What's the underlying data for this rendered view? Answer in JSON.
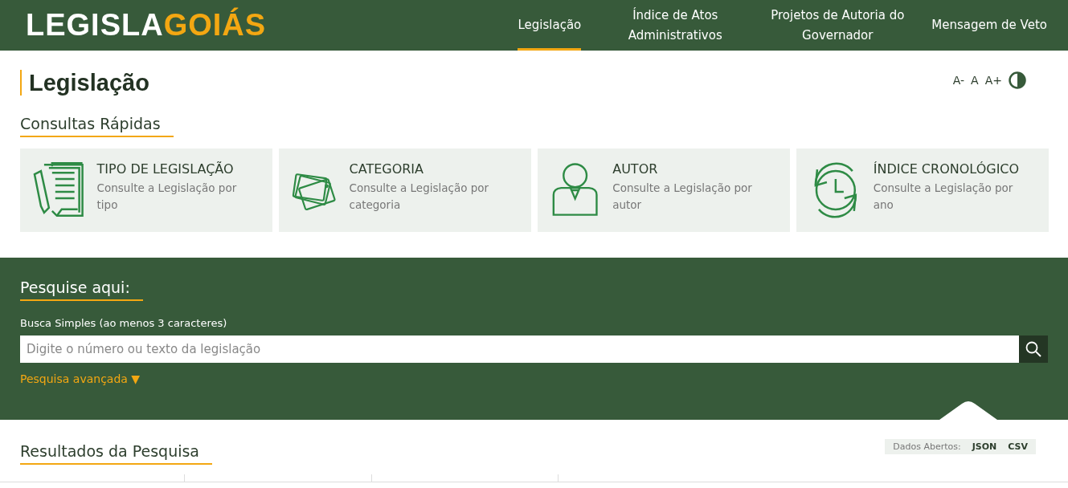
{
  "header": {
    "logo_primary": "LEGISLA",
    "logo_accent": "GOIÁS",
    "nav": [
      {
        "label": "Legislação",
        "selected": true
      },
      {
        "label": "Índice de Atos Administrativos",
        "selected": false
      },
      {
        "label": "Projetos de Autoria do Governador",
        "selected": false
      },
      {
        "label": "Mensagem de Veto",
        "selected": false
      }
    ]
  },
  "page_title": "Legislação",
  "font_controls": [
    "A-",
    "A",
    "A+"
  ],
  "quick_section": {
    "title": "Consultas Rápidas",
    "cards": [
      {
        "kind": "document",
        "title": "TIPO DE LEGISLAÇÃO",
        "description": "Consulte a Legislação por tipo"
      },
      {
        "kind": "cards",
        "title": "CATEGORIA",
        "description": "Consulte a Legislação por categoria"
      },
      {
        "kind": "person",
        "title": "AUTOR",
        "description": "Consulte a Legislação por autor"
      },
      {
        "kind": "clock",
        "title": "ÍNDICE CRONOLÓGICO",
        "description": "Consulte a Legislação por ano"
      }
    ]
  },
  "search": {
    "title": "Pesquise aqui:",
    "label": "Busca Simples (ao menos 3 caracteres)",
    "placeholder": "Digite o número ou texto da legislação",
    "advanced_link": "Pesquisa avançada ▼"
  },
  "results": {
    "title": "Resultados da Pesquisa",
    "open_data_label": "Dados Abertos:",
    "formats": [
      "JSON",
      "CSV"
    ]
  }
}
